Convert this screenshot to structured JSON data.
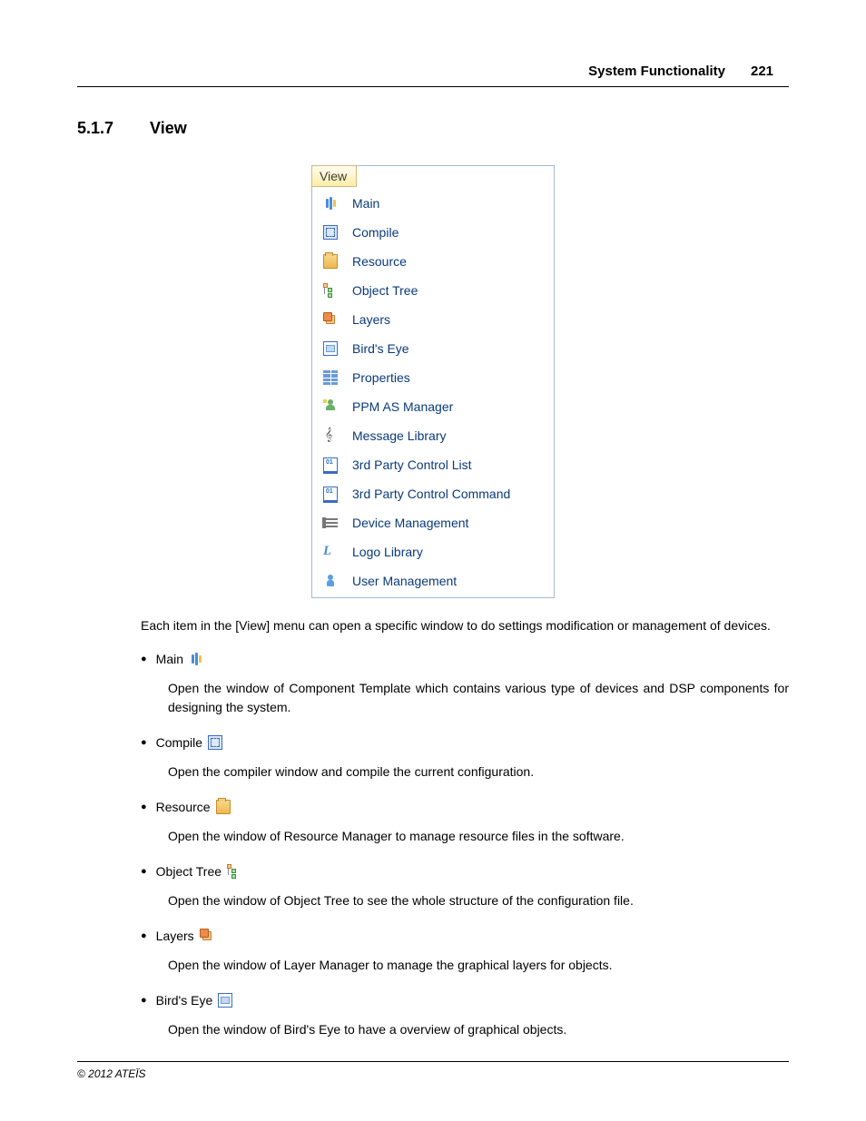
{
  "header": {
    "title": "System Functionality",
    "page": "221"
  },
  "section": {
    "number": "5.1.7",
    "title": "View"
  },
  "menu": {
    "title": "View",
    "items": [
      {
        "label": "Main",
        "icon": "main"
      },
      {
        "label": "Compile",
        "icon": "compile"
      },
      {
        "label": "Resource",
        "icon": "resource"
      },
      {
        "label": "Object Tree",
        "icon": "tree"
      },
      {
        "label": "Layers",
        "icon": "layers"
      },
      {
        "label": "Bird's Eye",
        "icon": "birdseye"
      },
      {
        "label": "Properties",
        "icon": "props"
      },
      {
        "label": "PPM AS Manager",
        "icon": "ppm"
      },
      {
        "label": "Message Library",
        "icon": "msg"
      },
      {
        "label": "3rd Party Control List",
        "icon": "3rd"
      },
      {
        "label": "3rd Party Control Command",
        "icon": "3rd"
      },
      {
        "label": "Device Management",
        "icon": "device"
      },
      {
        "label": "Logo Library",
        "icon": "logo"
      },
      {
        "label": "User Management",
        "icon": "user"
      }
    ]
  },
  "intro": "Each item in the [View] menu can open a specific window to do settings modification or management of devices.",
  "items": [
    {
      "name": "Main",
      "icon": "main",
      "desc": "Open the window of Component Template which contains various type of devices and DSP components for designing the system."
    },
    {
      "name": "Compile",
      "icon": "compile",
      "desc": "Open the compiler window and compile the current configuration."
    },
    {
      "name": "Resource",
      "icon": "resource",
      "desc": "Open the window of Resource Manager to manage resource files in the software."
    },
    {
      "name": "Object Tree",
      "icon": "tree",
      "desc": "Open the window of Object Tree to see the whole structure of the configuration file."
    },
    {
      "name": "Layers",
      "icon": "layers",
      "desc": "Open the window of Layer Manager to manage the graphical layers for objects."
    },
    {
      "name": "Bird's Eye",
      "icon": "birdseye",
      "desc": "Open the window of Bird's Eye to have a overview of graphical objects."
    }
  ],
  "footer": "© 2012 ATEÏS"
}
